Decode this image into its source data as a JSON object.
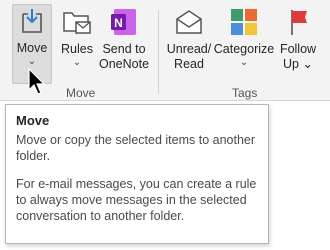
{
  "ribbon": {
    "move_group": {
      "label": "Move",
      "move_button": {
        "label": "Move",
        "chevron": "⌄"
      },
      "rules_button": {
        "label": "Rules",
        "chevron": "⌄"
      },
      "onenote_button": {
        "label_line1": "Send to",
        "label_line2": "OneNote"
      }
    },
    "tags_group": {
      "label": "Tags",
      "unread_button": {
        "label_line1": "Unread/",
        "label_line2": "Read"
      },
      "categorize_button": {
        "label": "Categorize",
        "chevron": "⌄"
      },
      "followup_button": {
        "label_line1": "Follow",
        "label_line2": "Up",
        "chevron": "⌄"
      }
    }
  },
  "tooltip": {
    "title": "Move",
    "description": "Move or copy the selected items to another folder.",
    "detail": "For e-mail messages, you can create a rule to always move messages in the selected conversation to another folder."
  },
  "colors": {
    "onenote_purple": "#7719aa",
    "flag_red": "#e0393e",
    "accent_blue": "#2b7cd3"
  }
}
